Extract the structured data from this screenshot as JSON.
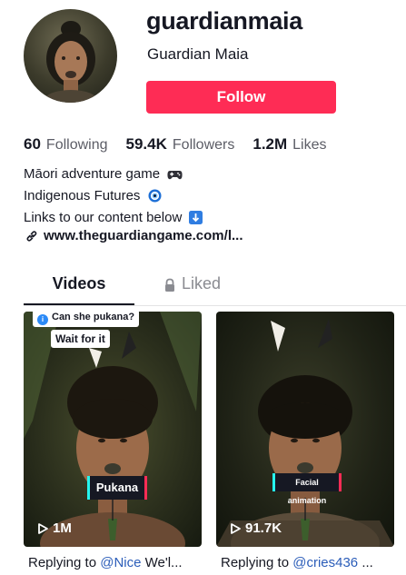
{
  "profile": {
    "username": "guardianmaia",
    "display_name": "Guardian Maia",
    "follow_label": "Follow"
  },
  "stats": [
    {
      "value": "60",
      "label": "Following"
    },
    {
      "value": "59.4K",
      "label": "Followers"
    },
    {
      "value": "1.2M",
      "label": "Likes"
    }
  ],
  "bio": {
    "line1": "Māori adventure game",
    "line1_emoji": "🎮",
    "line2": "Indigenous Futures",
    "line2_emoji": "🧿",
    "line3": "Links to our content below",
    "line3_emoji": "⬇️"
  },
  "link": {
    "text": "www.theguardiangame.com/l..."
  },
  "tabs": {
    "videos": "Videos",
    "liked": "Liked"
  },
  "videos": [
    {
      "views": "1M",
      "top_bubble": "Can she pukana?",
      "overlay": "Wait for it",
      "tag": "Pukana",
      "caption_prefix": "Replying to ",
      "mention": "@Nice",
      "caption_suffix": " We'l..."
    },
    {
      "views": "91.7K",
      "tag": "Facial animation",
      "caption_prefix": "Replying to ",
      "mention": "@cries436",
      "caption_suffix": " ..."
    }
  ],
  "colors": {
    "follow": "#fe2c55",
    "mention": "#2b5db9",
    "cyan": "#25f4ee"
  }
}
